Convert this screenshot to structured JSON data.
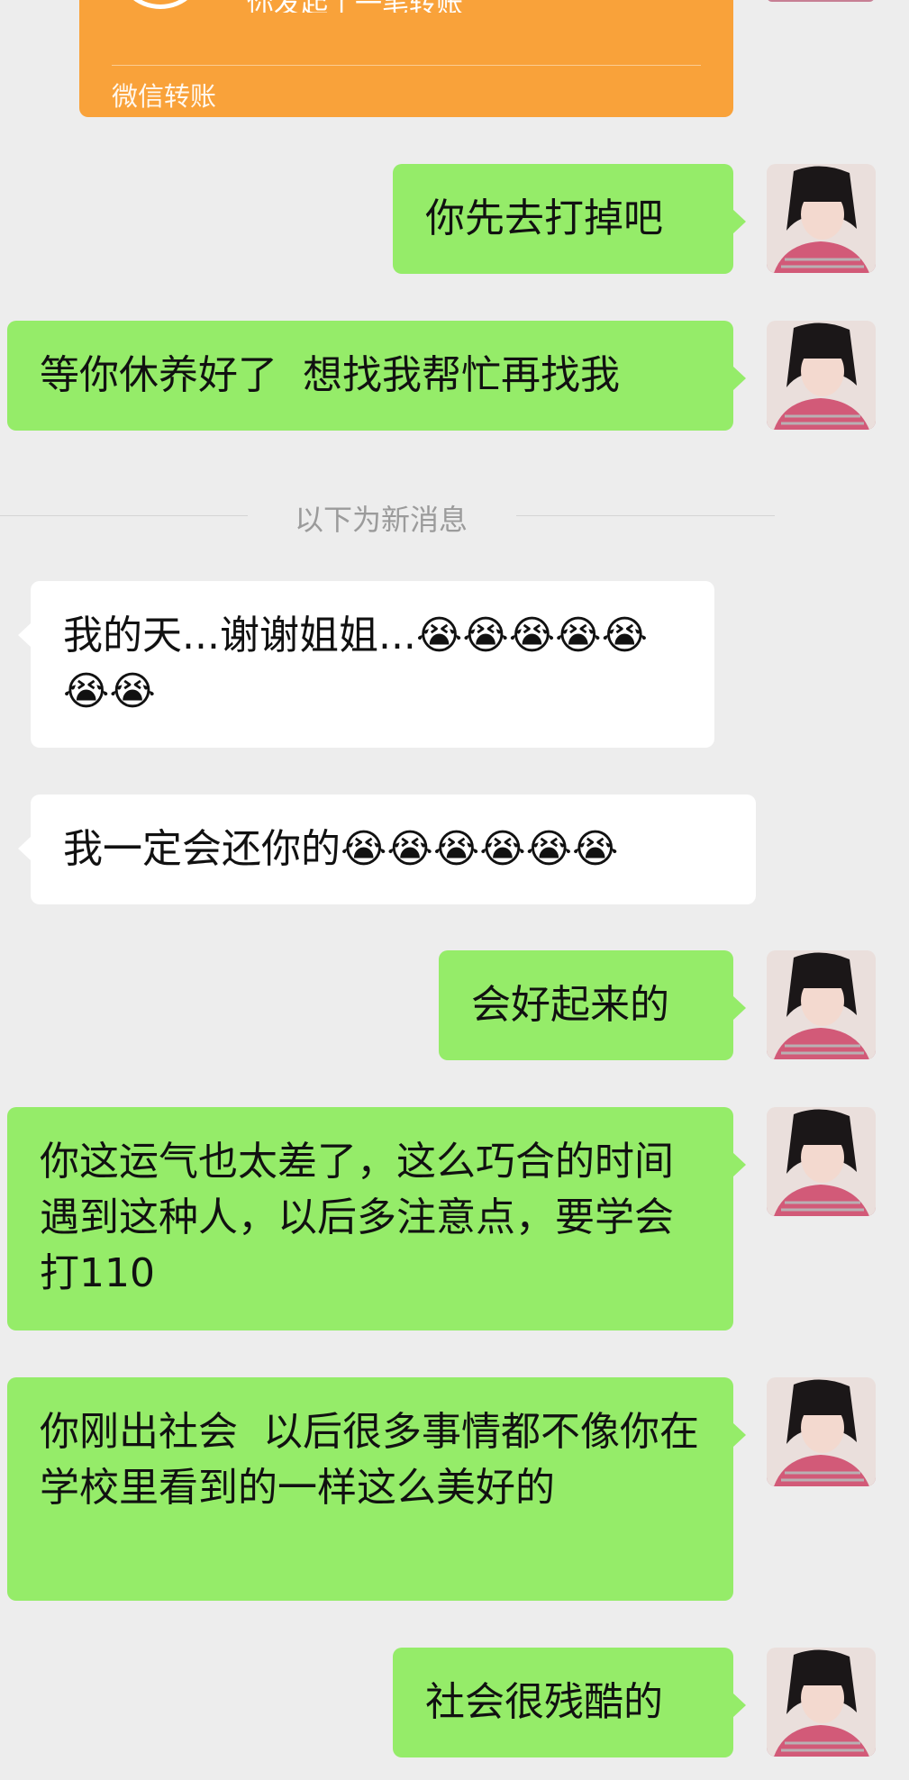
{
  "transfer": {
    "text": "你发起了一笔转账",
    "footer": "微信转账",
    "color": "#f9a23a"
  },
  "system": {
    "new_messages_label": "以下为新消息"
  },
  "messages": [
    {
      "side": "right",
      "text": "你先去打掉吧"
    },
    {
      "side": "right",
      "text": "等你休养好了  想找我帮忙再找我"
    },
    {
      "side": "left",
      "text": "我的天...谢谢姐姐...😭😭😭😭😭😭😭"
    },
    {
      "side": "left",
      "text": "我一定会还你的😭😭😭😭😭😭"
    },
    {
      "side": "right",
      "text": "会好起来的"
    },
    {
      "side": "right",
      "text": "你这运气也太差了，这么巧合的时间遇到这种人，以后多注意点，要学会打110"
    },
    {
      "side": "right",
      "text": "你刚出社会  以后很多事情都不像你在学校里看到的一样这么美好的"
    },
    {
      "side": "right",
      "text": "社会很残酷的"
    }
  ],
  "colors": {
    "background": "#ededed",
    "outgoing_bubble": "#95ec69",
    "incoming_bubble": "#ffffff"
  }
}
